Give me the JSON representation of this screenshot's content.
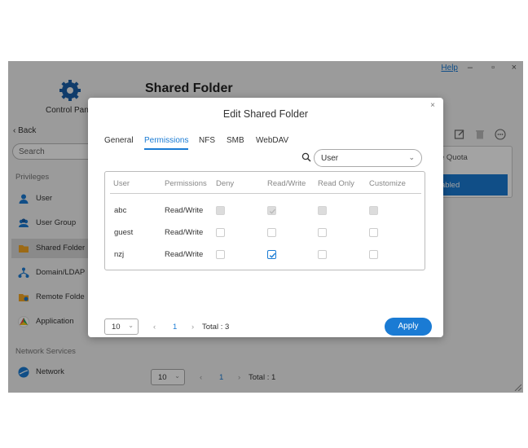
{
  "window": {
    "help_label": "Help",
    "minimize": "–",
    "maximize": "▫",
    "close": "×"
  },
  "sidebar": {
    "app_label": "Control Pan",
    "back_label": "Back",
    "search_placeholder": "Search",
    "sections": [
      {
        "title": "Privileges"
      },
      {
        "title": "Network Services"
      }
    ],
    "items": [
      {
        "label": "User",
        "icon": "user-icon"
      },
      {
        "label": "User Group",
        "icon": "user-group-icon"
      },
      {
        "label": "Shared Folder",
        "icon": "folder-icon"
      },
      {
        "label": "Domain/LDAP",
        "icon": "domain-icon"
      },
      {
        "label": "Remote Folde",
        "icon": "remote-folder-icon"
      },
      {
        "label": "Application",
        "icon": "application-icon"
      },
      {
        "label": "Network",
        "icon": "network-icon"
      }
    ]
  },
  "main": {
    "title": "Shared Folder",
    "quota_label": "e Quota",
    "enabled_label": "abled",
    "pager": {
      "page_size": "10",
      "page": "1",
      "total": "Total : 1"
    }
  },
  "modal": {
    "title": "Edit Shared Folder",
    "close": "×",
    "tabs": [
      {
        "label": "General",
        "active": false
      },
      {
        "label": "Permissions",
        "active": true
      },
      {
        "label": "NFS",
        "active": false
      },
      {
        "label": "SMB",
        "active": false
      },
      {
        "label": "WebDAV",
        "active": false
      }
    ],
    "filter": {
      "value": "User"
    },
    "table": {
      "columns": [
        "User",
        "Permissions",
        "Deny",
        "Read/Write",
        "Read Only",
        "Customize"
      ],
      "rows": [
        {
          "user": "abc",
          "permissions": "Read/Write",
          "deny": "disabled",
          "read_write": "disabled-checked",
          "read_only": "disabled",
          "customize": "disabled"
        },
        {
          "user": "guest",
          "permissions": "Read/Write",
          "deny": "unchecked",
          "read_write": "unchecked",
          "read_only": "unchecked",
          "customize": "unchecked"
        },
        {
          "user": "nzj",
          "permissions": "Read/Write",
          "deny": "unchecked",
          "read_write": "checked",
          "read_only": "unchecked",
          "customize": "unchecked"
        }
      ]
    },
    "footer": {
      "page_size": "10",
      "page": "1",
      "total": "Total : 3",
      "apply_label": "Apply"
    }
  },
  "colors": {
    "accent": "#1a7bd4"
  }
}
